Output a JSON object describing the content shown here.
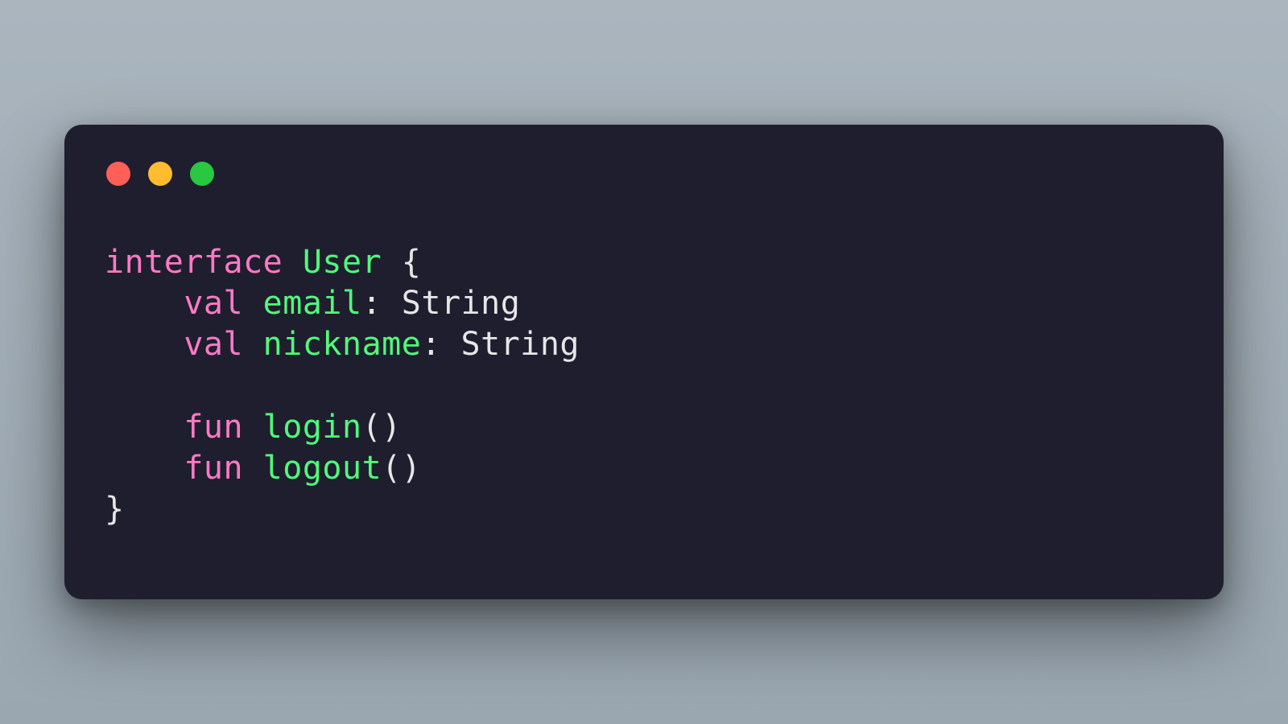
{
  "code": {
    "kw_interface": "interface",
    "type_user": "User",
    "brace_open": "{",
    "kw_val_1": "val",
    "id_email": "email",
    "colon_1": ":",
    "type_string_1": "String",
    "kw_val_2": "val",
    "id_nickname": "nickname",
    "colon_2": ":",
    "type_string_2": "String",
    "kw_fun_1": "fun",
    "id_login": "login",
    "parens_1": "()",
    "kw_fun_2": "fun",
    "id_logout": "logout",
    "parens_2": "()",
    "brace_close": "}"
  }
}
